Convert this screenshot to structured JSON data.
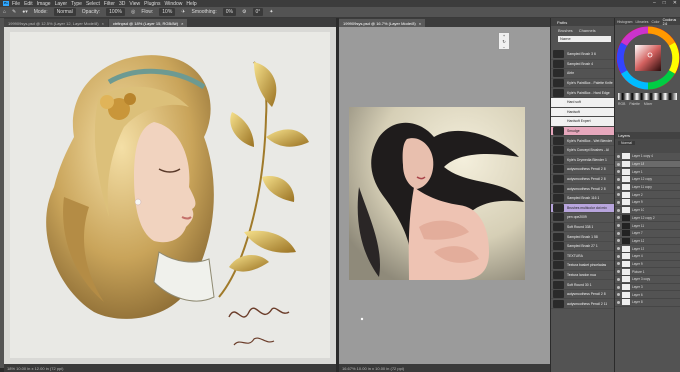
{
  "menubar": {
    "logo": "Ps",
    "items": [
      "File",
      "Edit",
      "Image",
      "Layer",
      "Type",
      "Select",
      "Filter",
      "3D",
      "View",
      "Plugins",
      "Window",
      "Help"
    ]
  },
  "options": {
    "mode_label": "Mode:",
    "mode_value": "Normal",
    "opacity_label": "Opacity:",
    "opacity_value": "100%",
    "flow_label": "Flow:",
    "flow_value": "10%",
    "smoothing_label": "Smoothing:",
    "smoothing_value": "0%",
    "angle_value": "0°"
  },
  "tabs_left": [
    {
      "label": "199909sys.psd @ 12.5% (Layer 12, Layer Mode/8)",
      "active": false
    },
    {
      "label": "ctrfinpsd @ 18% (Layer 15, RGB/8#)",
      "active": true
    }
  ],
  "tabs_right": [
    {
      "label": "199909sys.psd @ 16.7% (Layer Mode/8)",
      "active": true
    }
  ],
  "status_left": "18%    10.00 in x 12.00 in (72 ppi)",
  "status_right": "16.67%    10.00 in x 10.00 in (72 ppi)",
  "brushes_panel": {
    "title": "Paths",
    "tab1": "Brushes",
    "tab2": "Channels",
    "search_placeholder": "Name",
    "items": [
      {
        "name": "Sampled Brush 3 6",
        "style": ""
      },
      {
        "name": "Sampled Brush 4",
        "style": ""
      },
      {
        "name": "Airbr",
        "style": ""
      },
      {
        "name": "Kyle's PaintBox - Palette Knife",
        "style": ""
      },
      {
        "name": "Kyle's PaintBox - Hard Edge",
        "style": ""
      },
      {
        "name": "Hard soft",
        "style": "white"
      },
      {
        "name": "Hardsoft",
        "style": "white"
      },
      {
        "name": "Hardsoft Expert",
        "style": "white"
      },
      {
        "name": "Smudge",
        "style": "sel"
      },
      {
        "name": "Kyle's PaintBox - Wet Blender",
        "style": ""
      },
      {
        "name": "Kyle's Concept Brushes - Al",
        "style": ""
      },
      {
        "name": "Kyle's Drymedia Blender 1",
        "style": ""
      },
      {
        "name": "autysmoothess Pencil 2 8",
        "style": ""
      },
      {
        "name": "autysmoothess Pencil 2 8",
        "style": ""
      },
      {
        "name": "autysmoothess Pencil 2 8",
        "style": ""
      },
      {
        "name": "Sampled Brush 116 1",
        "style": ""
      },
      {
        "name": "Brushes multicolor dot mix",
        "style": "sel2"
      },
      {
        "name": "pen ope2009",
        "style": ""
      },
      {
        "name": "Soft Round 338 1",
        "style": ""
      },
      {
        "name": "Sampled Brush 1 58",
        "style": ""
      },
      {
        "name": "Sampled Brush 27 1",
        "style": ""
      },
      {
        "name": "TEXTURA",
        "style": ""
      },
      {
        "name": "Textura basket pinceladas",
        "style": ""
      },
      {
        "name": "Textura landon nua",
        "style": ""
      },
      {
        "name": "Soft Round 30 1",
        "style": ""
      },
      {
        "name": "autysmoothess Pencil 2 8",
        "style": ""
      },
      {
        "name": "autysmoothess Pencil 2 11",
        "style": ""
      }
    ]
  },
  "coolorus": {
    "tabs": [
      "Histogram",
      "Libraries",
      "Color",
      "Coolorus 2.6"
    ],
    "active_tab": "Coolorus 2.6",
    "selected_color": "#d3615f",
    "mode_labels": [
      "RGB",
      "Palette",
      "Mixer"
    ]
  },
  "layers": {
    "title": "Layers",
    "blend": "Normal",
    "items": [
      {
        "name": "Layer 1 copy 4",
        "dark": false,
        "active": false
      },
      {
        "name": "Layer 18",
        "dark": false,
        "active": true
      },
      {
        "name": "Layer 1",
        "dark": false,
        "active": false
      },
      {
        "name": "Layer 12 copy",
        "dark": false,
        "active": false
      },
      {
        "name": "Layer 11 copy",
        "dark": false,
        "active": false
      },
      {
        "name": "Layer 2",
        "dark": false,
        "active": false
      },
      {
        "name": "Layer 9",
        "dark": false,
        "active": false
      },
      {
        "name": "Layer 10",
        "dark": false,
        "active": false
      },
      {
        "name": "Layer 12 copy 2",
        "dark": true,
        "active": false
      },
      {
        "name": "Layer 11",
        "dark": true,
        "active": false
      },
      {
        "name": "Layer 7",
        "dark": true,
        "active": false
      },
      {
        "name": "Layer 12",
        "dark": true,
        "active": false
      },
      {
        "name": "Layer 13",
        "dark": false,
        "active": false
      },
      {
        "name": "Layer 4",
        "dark": false,
        "active": false
      },
      {
        "name": "Layer 9",
        "dark": false,
        "active": false
      },
      {
        "name": "Picture 1",
        "dark": false,
        "active": false
      },
      {
        "name": "Layer 3 copy",
        "dark": false,
        "active": false
      },
      {
        "name": "Layer 3",
        "dark": false,
        "active": false
      },
      {
        "name": "Layer 6",
        "dark": false,
        "active": false
      },
      {
        "name": "Layer 8",
        "dark": false,
        "active": false
      }
    ]
  }
}
